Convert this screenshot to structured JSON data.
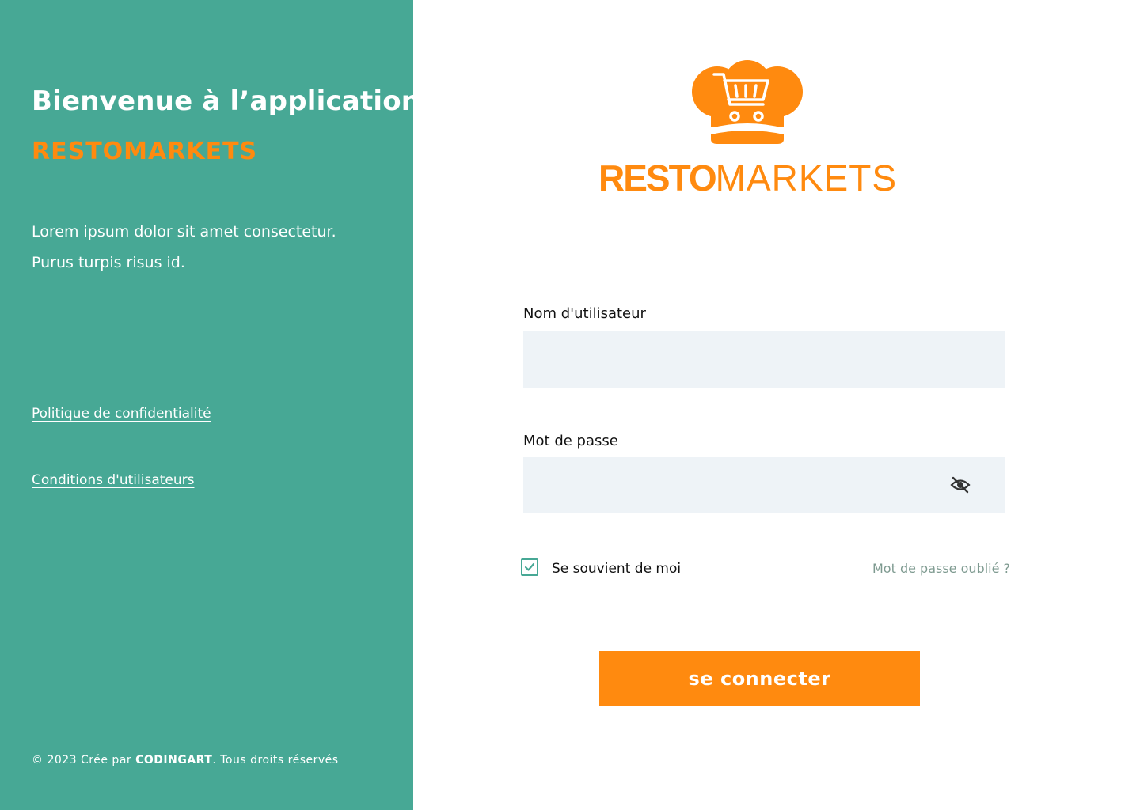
{
  "colors": {
    "panel": "#47a895",
    "accent": "#ff8a0f",
    "field_bg": "#eef3f7",
    "forgot_link": "#7e9a90"
  },
  "sidebar": {
    "welcome": "Bienvenue à l’application",
    "brand": "RESTOMARKETS",
    "intro_line1": "Lorem ipsum dolor sit amet consectetur.",
    "intro_line2": "Purus turpis risus id.",
    "privacy_link": "Politique de confidentialité",
    "terms_link": "Conditions d'utilisateurs",
    "copyright_prefix": "© 2023 Crée par",
    "copyright_company": "CODINGART",
    "copyright_suffix": ". Tous droits réservés"
  },
  "logo": {
    "icon": "chef-hat-cart-icon",
    "word_bold": "RESTO",
    "word_thin": "MARKETS"
  },
  "form": {
    "username_label": "Nom d'utilisateur",
    "username_value": "",
    "password_label": "Mot de passe",
    "password_value": "",
    "password_toggle_icon": "eye-off-icon",
    "remember_label": "Se souvient de moi",
    "remember_checked": true,
    "forgot_link": "Mot de passe oublié ?",
    "submit_label": "se connecter"
  }
}
